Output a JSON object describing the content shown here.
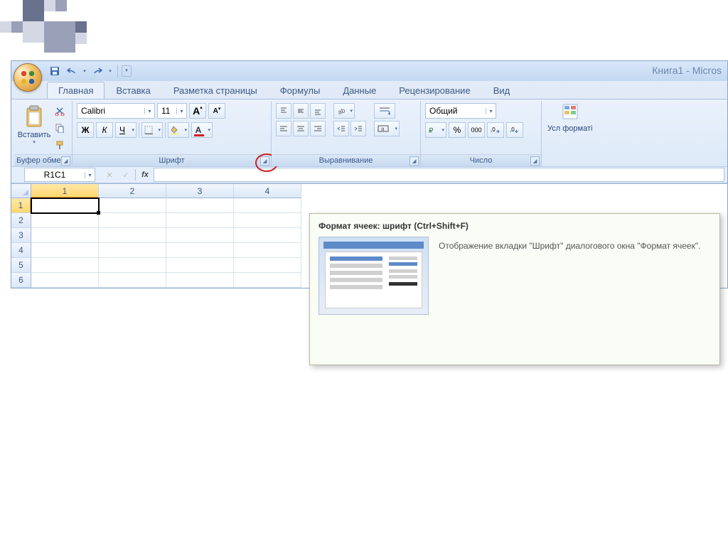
{
  "decoration": {
    "color_light": "#d4d8e4",
    "color_mid": "#9aa0b8",
    "color_dark": "#6a718c"
  },
  "window": {
    "title": "Книга1 - Micros"
  },
  "qat": {
    "save": "save-icon",
    "undo": "undo-icon",
    "redo": "redo-icon"
  },
  "tabs": {
    "home": "Главная",
    "insert": "Вставка",
    "layout": "Разметка страницы",
    "formulas": "Формулы",
    "data": "Данные",
    "review": "Рецензирование",
    "view": "Вид"
  },
  "groups": {
    "clipboard": {
      "label": "Буфер обмена",
      "paste": "Вставить"
    },
    "font": {
      "label": "Шрифт",
      "name": "Calibri",
      "size": "11",
      "bold": "Ж",
      "italic": "К",
      "underline": "Ч"
    },
    "alignment": {
      "label": "Выравнивание"
    },
    "number": {
      "label": "Число",
      "format": "Общий",
      "percent": "%",
      "thousands": "000"
    },
    "styles": {
      "conditional": "Усл форматі"
    }
  },
  "formula_bar": {
    "name_box": "R1C1",
    "fx": "fx"
  },
  "sheet": {
    "columns": [
      "1",
      "2",
      "3",
      "4"
    ],
    "rows": [
      "1",
      "2",
      "3",
      "4",
      "5",
      "6"
    ]
  },
  "tooltip": {
    "title": "Формат ячеек: шрифт (Ctrl+Shift+F)",
    "text": "Отображение вкладки \"Шрифт\" диалогового окна \"Формат ячеек\"."
  }
}
